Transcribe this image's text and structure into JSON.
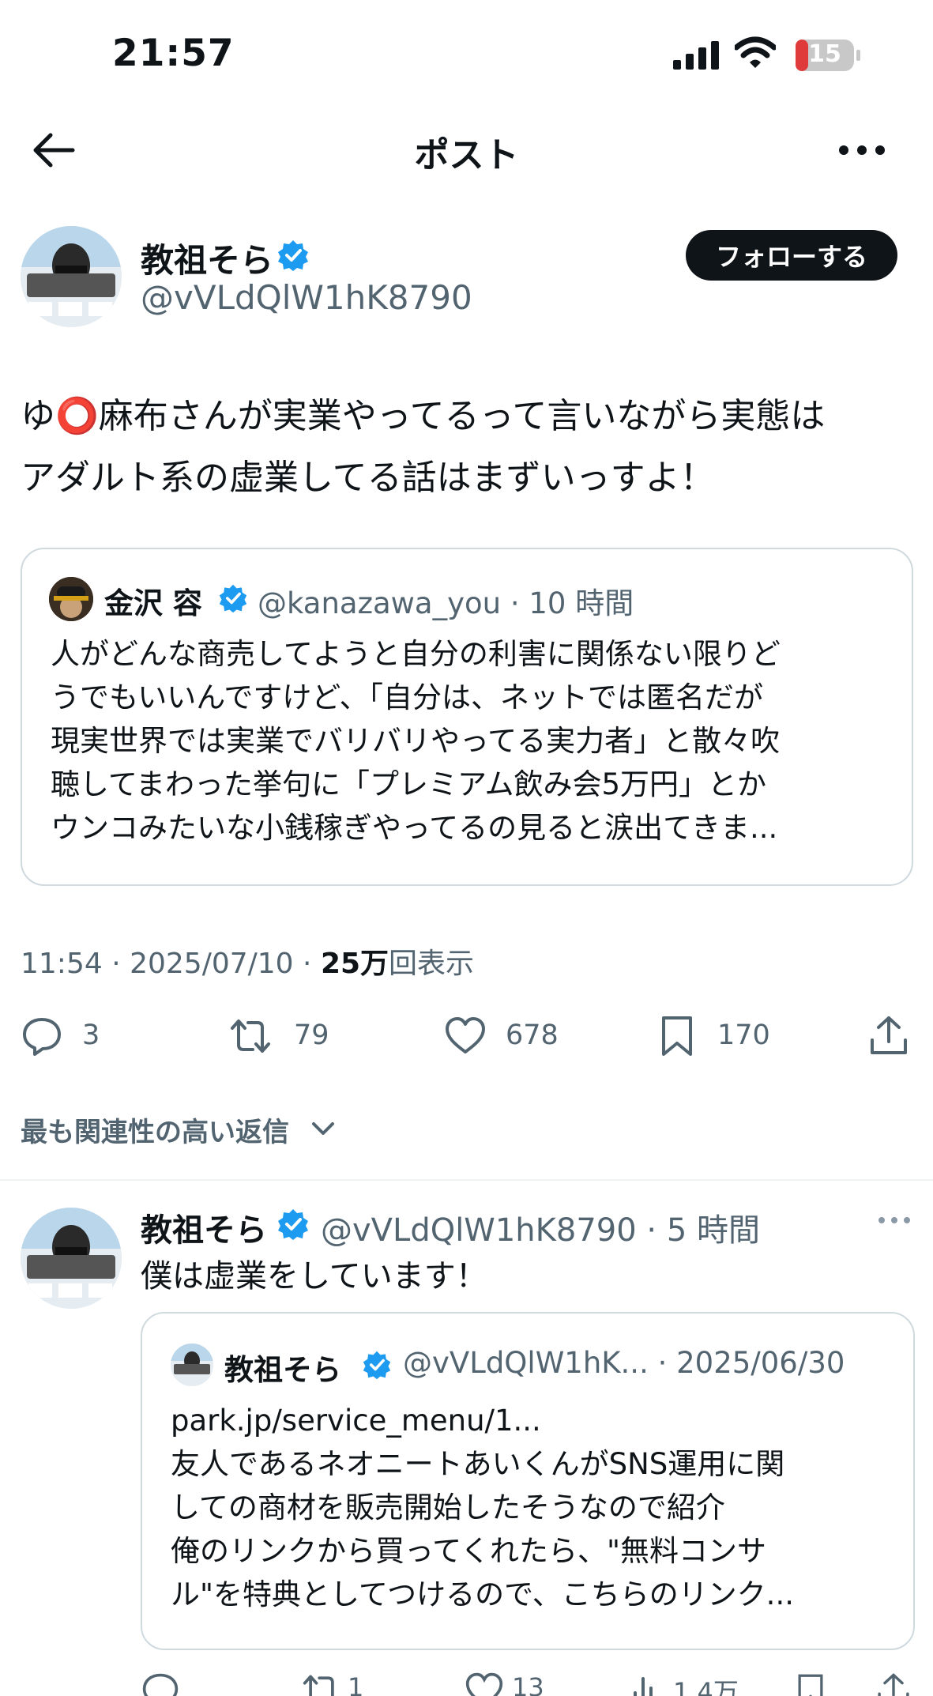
{
  "status_bar": {
    "time": "21:57",
    "battery": "15"
  },
  "header": {
    "title": "ポスト"
  },
  "post": {
    "author_name": "教祖そら",
    "author_handle": "@vVLdQlW1hK8790",
    "follow_label": "フォローする",
    "text_line1": "ゆ⭕️麻布さんが実業やってるって言いながら実態は",
    "text_line2": "アダルト系の虚業してる話はまずいっすよ！",
    "quote": {
      "author_name": "金沢 容",
      "author_handle": "@kanazawa_you",
      "time": "10 時間",
      "text": "人がどんな商売してようと自分の利害に関係ない限りど\nうでもいいんですけど、「自分は、ネットでは匿名だが\n現実世界では実業でバリバリやってる実力者」と散々吹\n聴してまわった挙句に「プレミアム飲み会5万円」とか\nウンコみたいな小銭稼ぎやってるの見ると涙出てきま..."
    },
    "meta": {
      "time": "11:54",
      "date": "2025/07/10",
      "views_bold": "25万",
      "views_suffix": "回表示"
    },
    "actions": {
      "replies": "3",
      "reposts": "79",
      "likes": "678",
      "bookmarks": "170"
    }
  },
  "replies_sort": {
    "label": "最も関連性の高い返信"
  },
  "reply": {
    "author_name": "教祖そら",
    "author_handle": "@vVLdQlW1hK8790",
    "time": "5 時間",
    "text": "僕は虚業をしています！",
    "quote": {
      "author_name": "教祖そら",
      "author_handle": "@vVLdQlW1hK...",
      "date": "2025/06/30",
      "text": "park.jp/service_menu/1...\n友人であるネオニートあいくんがSNS運用に関\nしての商材を販売開始したそうなので紹介\n俺のリンクから買ってくれたら、\"無料コンサ\nル\"を特典としてつけるので、こちらのリンク..."
    },
    "actions": {
      "replies": "",
      "reposts": "1",
      "likes": "13",
      "views": "1.4万"
    }
  },
  "colors": {
    "text": "#0f1419",
    "secondary": "#536471",
    "verified": "#1d9bf0",
    "border": "#cfd9de"
  }
}
